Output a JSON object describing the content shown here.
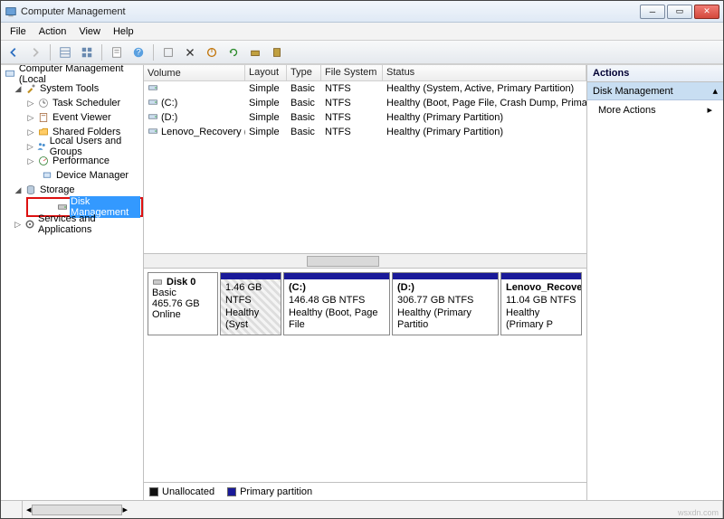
{
  "window": {
    "title": "Computer Management"
  },
  "menubar": [
    "File",
    "Action",
    "View",
    "Help"
  ],
  "tree": {
    "root": "Computer Management (Local",
    "system_tools": "System Tools",
    "task_scheduler": "Task Scheduler",
    "event_viewer": "Event Viewer",
    "shared_folders": "Shared Folders",
    "local_users": "Local Users and Groups",
    "performance": "Performance",
    "device_manager": "Device Manager",
    "storage": "Storage",
    "disk_management": "Disk Management",
    "services_apps": "Services and Applications"
  },
  "volumes": {
    "headers": [
      "Volume",
      "Layout",
      "Type",
      "File System",
      "Status"
    ],
    "rows": [
      {
        "name": "",
        "layout": "Simple",
        "type": "Basic",
        "fs": "NTFS",
        "status": "Healthy (System, Active, Primary Partition)"
      },
      {
        "name": "(C:)",
        "layout": "Simple",
        "type": "Basic",
        "fs": "NTFS",
        "status": "Healthy (Boot, Page File, Crash Dump, Primary Partition"
      },
      {
        "name": "(D:)",
        "layout": "Simple",
        "type": "Basic",
        "fs": "NTFS",
        "status": "Healthy (Primary Partition)"
      },
      {
        "name": "Lenovo_Recovery (E:)",
        "layout": "Simple",
        "type": "Basic",
        "fs": "NTFS",
        "status": "Healthy (Primary Partition)"
      }
    ]
  },
  "disk": {
    "label": "Disk 0",
    "type": "Basic",
    "size": "465.76 GB",
    "state": "Online",
    "partitions": [
      {
        "name": "",
        "info": "1.46 GB NTFS",
        "status": "Healthy (Syst",
        "w": 68,
        "hatched": true
      },
      {
        "name": "(C:)",
        "info": "146.48 GB NTFS",
        "status": "Healthy (Boot, Page File",
        "w": 118,
        "hatched": false
      },
      {
        "name": "(D:)",
        "info": "306.77 GB NTFS",
        "status": "Healthy (Primary Partitio",
        "w": 118,
        "hatched": false
      },
      {
        "name": "Lenovo_Recovery",
        "info": "11.04 GB NTFS",
        "status": "Healthy (Primary P",
        "w": 90,
        "hatched": false
      }
    ]
  },
  "legend": {
    "unallocated": "Unallocated",
    "primary": "Primary partition"
  },
  "actions": {
    "header": "Actions",
    "sub": "Disk Management",
    "more": "More Actions"
  },
  "watermark": "wsxdn.com"
}
